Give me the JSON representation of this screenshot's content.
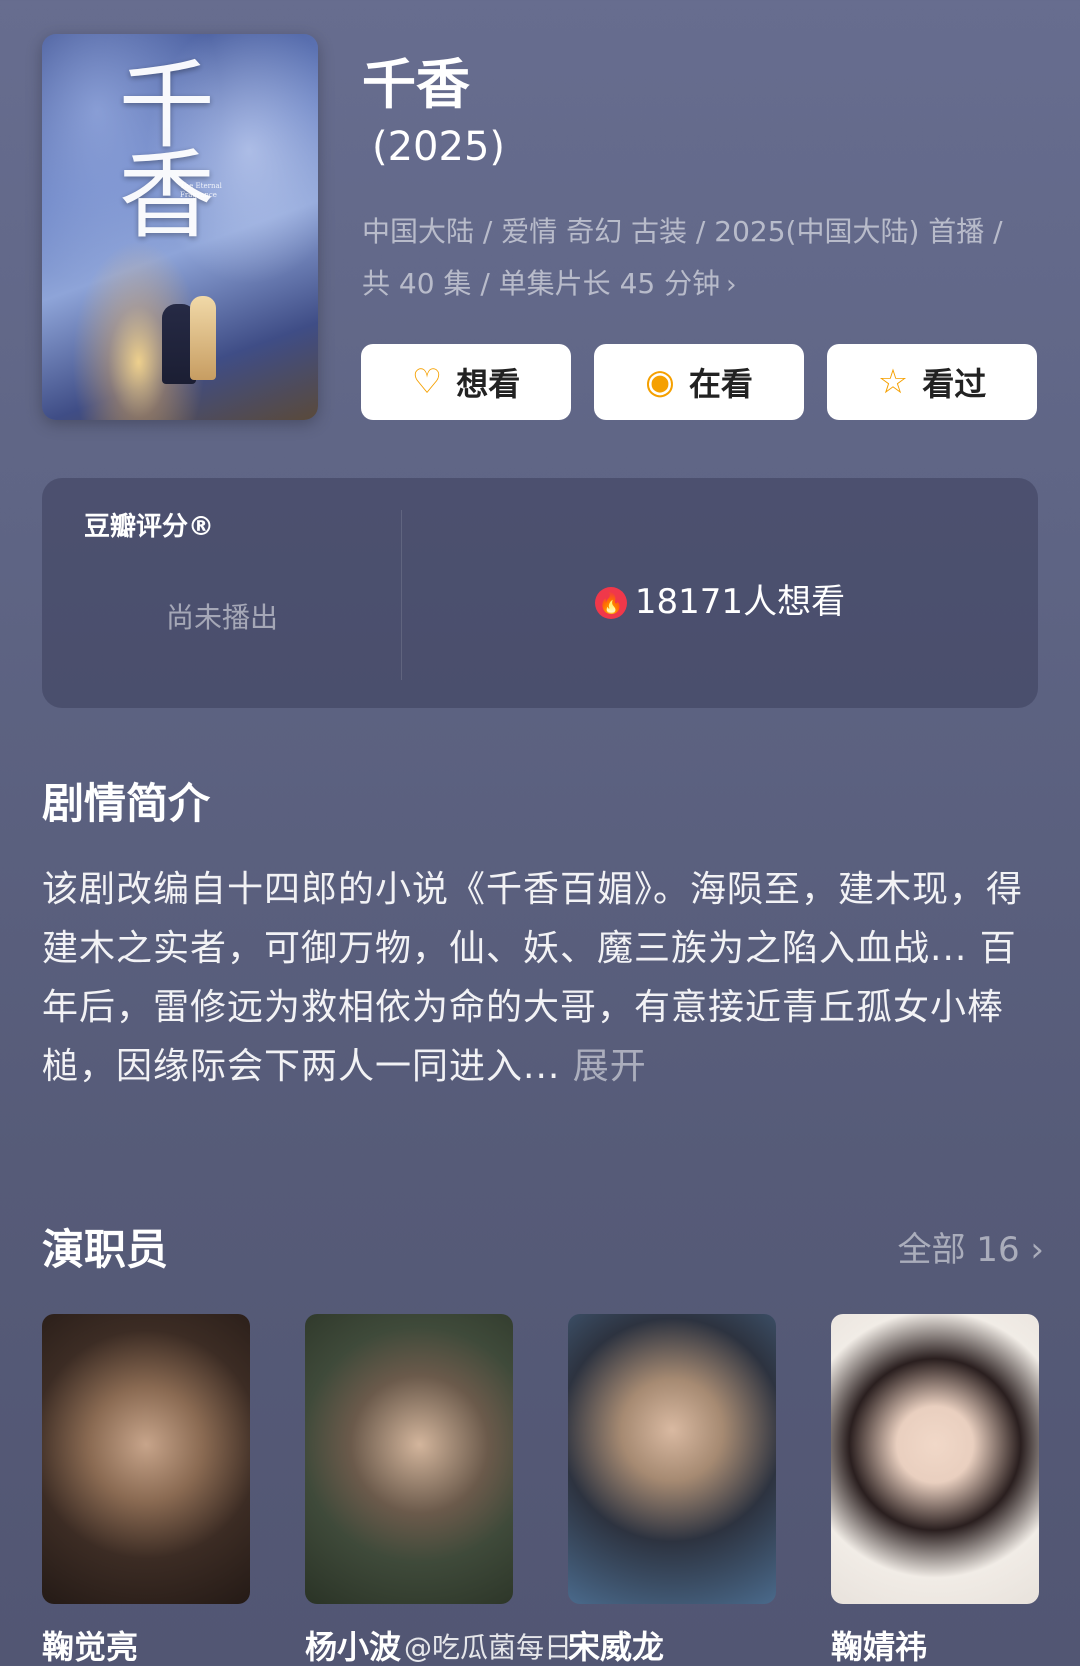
{
  "show": {
    "title": "千香",
    "year": "(2025)",
    "meta_line1": "中国大陆 / 爱情 奇幻 古装 / 2025(中国大陆) 首播 /",
    "meta_line2": "共 40 集 / 单集片长 45 分钟",
    "poster_title": "千香",
    "poster_subtitle": "The Eternal Fragrance"
  },
  "actions": {
    "want": "想看",
    "watching": "在看",
    "watched": "看过"
  },
  "rating": {
    "label": "豆瓣评分®",
    "status": "尚未播出",
    "want_count": "18171人想看"
  },
  "synopsis": {
    "title": "剧情简介",
    "text": "该剧改编自十四郎的小说《千香百媚》。海陨至，建木现，得建木之实者，可御万物，仙、妖、魔三族为之陷入血战... 百年后，雷修远为救相依为命的大哥，有意接近青丘孤女小棒槌，因缘际会下两人一同进入... ",
    "expand": "展开"
  },
  "cast": {
    "title": "演职员",
    "all": "全部 16",
    "members": [
      "鞠觉亮",
      "杨小波",
      "宋威龙",
      "鞠婧祎"
    ]
  },
  "watermark": "@吃瓜菌每日"
}
